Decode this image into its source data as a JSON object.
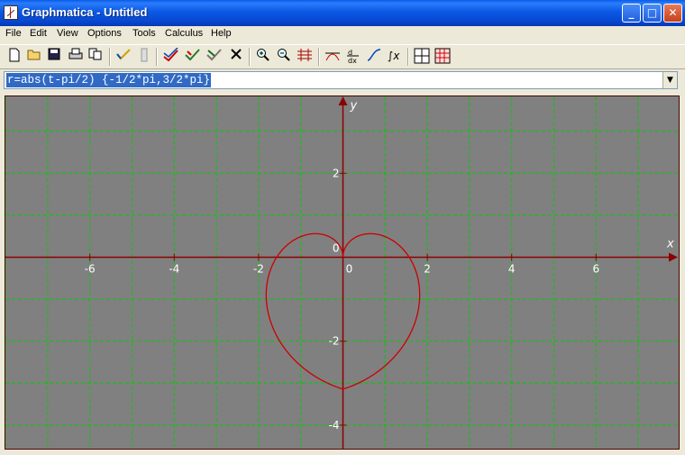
{
  "window": {
    "title": "Graphmatica - Untitled"
  },
  "menu": [
    "File",
    "Edit",
    "View",
    "Options",
    "Tools",
    "Calculus",
    "Help"
  ],
  "toolbar": {
    "buttons": [
      "new-file",
      "open-file",
      "save-file",
      "print",
      "copy",
      "draw-graph",
      "stop",
      "redraw-all",
      "delete-graph",
      "clear-graph",
      "erase",
      "zoom-in",
      "zoom-out",
      "grid-range",
      "tangent",
      "derivative",
      "inflection",
      "integral",
      "table",
      "data-plot"
    ]
  },
  "equation": {
    "value": "r=abs(t-pi/2) {-1/2*pi,3/2*pi}"
  },
  "graph": {
    "background": "#808080",
    "axis_color": "#8b0000",
    "grid_color": "#00cc00",
    "curve_color": "#cc0000",
    "x_label": "x",
    "y_label": "y",
    "x_ticks": [
      "-6",
      "-4",
      "-2",
      "0",
      "2",
      "4",
      "6"
    ],
    "y_ticks": [
      "2",
      "0",
      "-2",
      "-4"
    ]
  },
  "chart_data": {
    "type": "line",
    "equation": "r=abs(t-pi/2) {-1/2*pi,3/2*pi}",
    "polar": true,
    "t_range": [
      -1.5708,
      4.7124
    ],
    "xlim": [
      -8,
      8
    ],
    "ylim": [
      -4.6,
      3.75
    ],
    "x_tick_values": [
      -6,
      -4,
      -2,
      0,
      2,
      4,
      6
    ],
    "y_tick_values": [
      2,
      0,
      -2,
      -4
    ],
    "grid": true
  }
}
